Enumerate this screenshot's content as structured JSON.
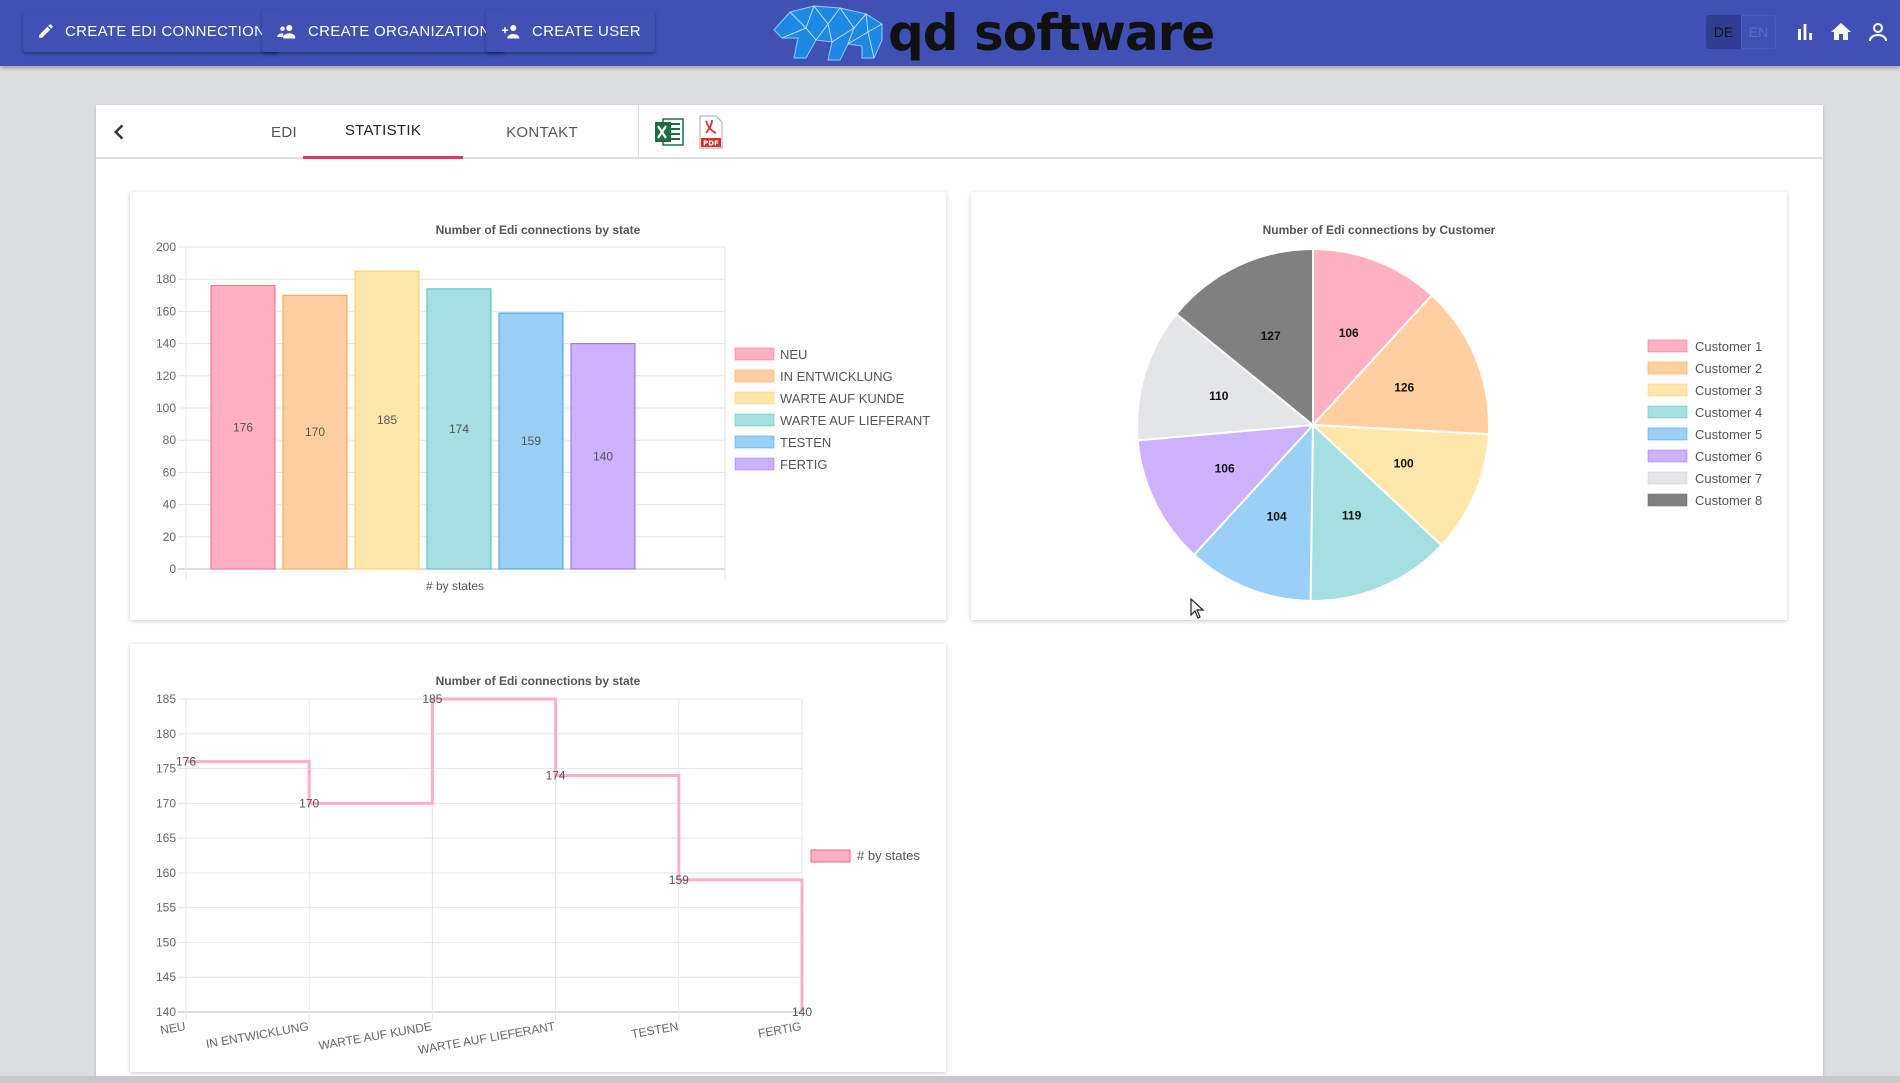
{
  "header": {
    "buttons": [
      {
        "label": "CREATE EDI CONNECTION",
        "icon": "pencil-icon"
      },
      {
        "label": "CREATE ORGANIZATION",
        "icon": "group-add-icon"
      },
      {
        "label": "CREATE USER",
        "icon": "person-add-icon"
      }
    ],
    "logo_text": "qd software",
    "lang": {
      "de": "DE",
      "en": "EN",
      "active": "DE"
    },
    "icons": [
      "bar-chart-icon",
      "home-icon",
      "account-icon"
    ]
  },
  "tabs": [
    {
      "label": "EDI",
      "active": false
    },
    {
      "label": "STATISTIK",
      "active": true
    },
    {
      "label": "KONTAKT",
      "active": false
    }
  ],
  "export_icons": [
    "excel-icon",
    "pdf-icon"
  ],
  "colors": {
    "primary": "#3f51b5",
    "tab_indicator": "#e0385a",
    "series": [
      "#ffb1c1",
      "#ffcf9f",
      "#ffe6aa",
      "#a5dfdf",
      "#9ad0f5",
      "#ccb2ff",
      "#e4e5e7",
      "#808080"
    ],
    "series_border": [
      "#ff6384",
      "#ff9f40",
      "#ffcd56",
      "#4bc0c0",
      "#36a2eb",
      "#9966ff",
      "#c9cbcf",
      "#666666"
    ]
  },
  "chart_data": [
    {
      "type": "bar",
      "title": "Number of Edi connections by state",
      "categories": [
        "NEU",
        "IN ENTWICKLUNG",
        "WARTE AUF KUNDE",
        "WARTE AUF LIEFERANT",
        "TESTEN",
        "FERTIG"
      ],
      "values": [
        176,
        170,
        185,
        174,
        159,
        140
      ],
      "xlabel": "# by states",
      "ylabel": "",
      "ylim": [
        0,
        200
      ],
      "yticks": [
        0,
        20,
        40,
        60,
        80,
        100,
        120,
        140,
        160,
        180,
        200
      ],
      "legend": "right",
      "grid": true
    },
    {
      "type": "pie",
      "title": "Number of Edi connections by Customer",
      "categories": [
        "Customer 1",
        "Customer 2",
        "Customer 3",
        "Customer 4",
        "Customer 5",
        "Customer 6",
        "Customer 7",
        "Customer 8"
      ],
      "values": [
        106,
        126,
        100,
        119,
        104,
        106,
        110,
        127
      ],
      "legend": "right"
    },
    {
      "type": "line",
      "title": "Number of Edi connections by state",
      "categories": [
        "NEU",
        "IN ENTWICKLUNG",
        "WARTE AUF KUNDE",
        "WARTE AUF LIEFERANT",
        "TESTEN",
        "FERTIG"
      ],
      "series": [
        {
          "name": "# by states",
          "values": [
            176,
            170,
            185,
            174,
            159,
            140
          ]
        }
      ],
      "ylim": [
        140,
        185
      ],
      "yticks": [
        140,
        145,
        150,
        155,
        160,
        165,
        170,
        175,
        180,
        185
      ],
      "stepped": true,
      "legend": "right",
      "grid": true
    }
  ]
}
